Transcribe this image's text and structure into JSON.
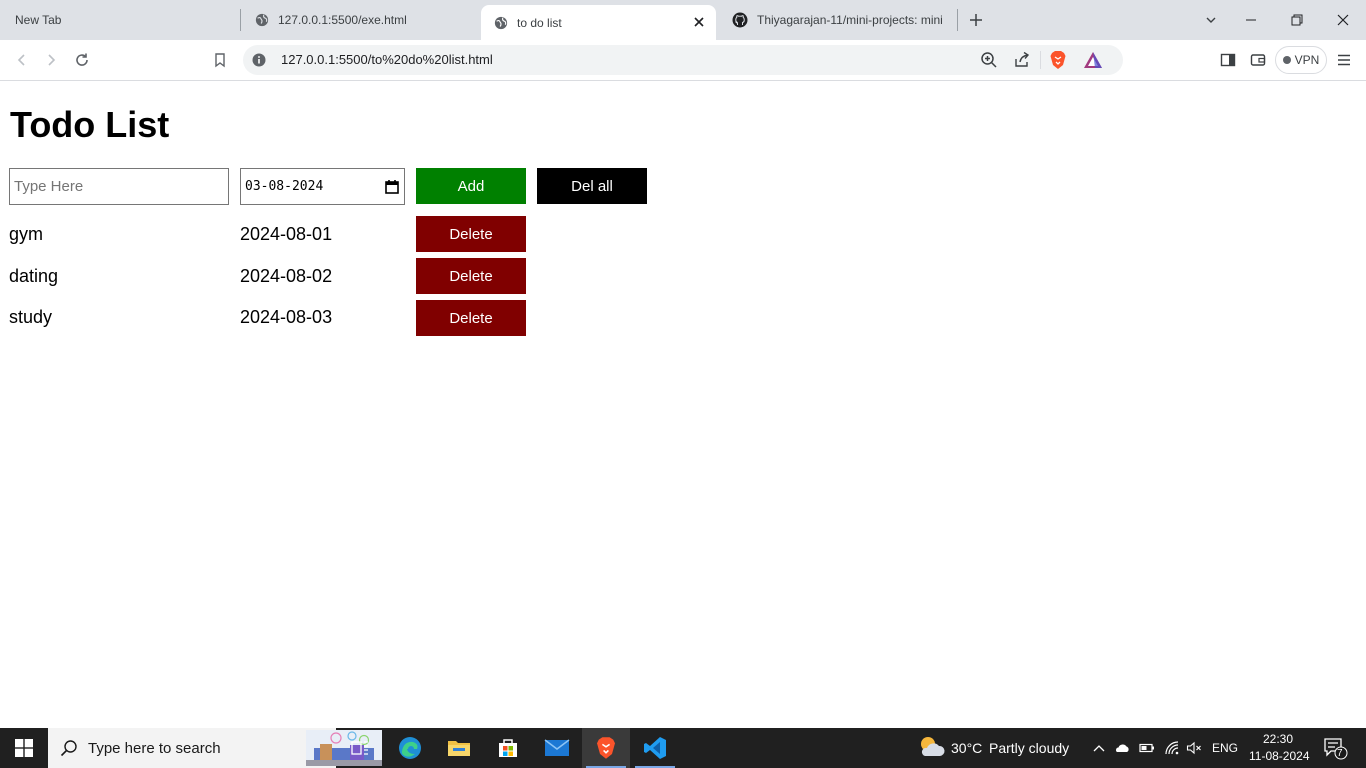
{
  "browser": {
    "tabs": [
      {
        "title": "New Tab",
        "active": false
      },
      {
        "title": "127.0.0.1:5500/exe.html",
        "active": false
      },
      {
        "title": "to do list",
        "active": true
      },
      {
        "title": "Thiyagarajan-11/mini-projects: mini",
        "active": false
      }
    ],
    "address": "127.0.0.1:5500/to%20do%20list.html",
    "vpn_label": "VPN"
  },
  "page": {
    "title": "Todo List",
    "input_placeholder": "Type Here",
    "input_value": "",
    "date_value": "03-08-2024",
    "add_label": "Add",
    "delete_all_label": "Del all",
    "todos": [
      {
        "name": "gym",
        "date": "2024-08-01",
        "delete_label": "Delete"
      },
      {
        "name": "dating",
        "date": "2024-08-02",
        "delete_label": "Delete"
      },
      {
        "name": "study",
        "date": "2024-08-03",
        "delete_label": "Delete"
      }
    ],
    "colors": {
      "add": "#008000",
      "delete_all": "#000000",
      "delete": "#800000"
    }
  },
  "taskbar": {
    "search_placeholder": "Type here to search",
    "weather_temp": "30°C",
    "weather_desc": "Partly cloudy",
    "language": "ENG",
    "time": "22:30",
    "date": "11-08-2024",
    "notification_count": "7"
  }
}
